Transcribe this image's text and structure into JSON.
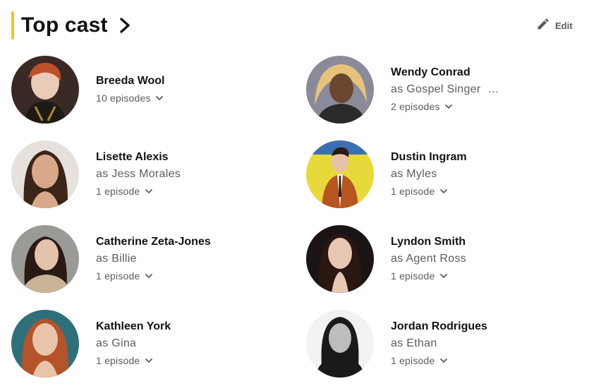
{
  "section": {
    "title": "Top cast",
    "edit_label": "Edit",
    "accent_color": "#f5c518"
  },
  "cast": [
    {
      "name": "Breeda Wool",
      "character": "",
      "episodes": "10 episodes",
      "avatar_bg": "#3a2a26",
      "avatar_fg": "#c0502a"
    },
    {
      "name": "Wendy Conrad",
      "character": "as Gospel Singer",
      "character_overflow": "…",
      "episodes": "2 episodes",
      "avatar_bg": "#8a8a9a",
      "avatar_fg": "#e6c27a"
    },
    {
      "name": "Lisette Alexis",
      "character": "as Jess Morales",
      "episodes": "1 episode",
      "avatar_bg": "#e6e1dc",
      "avatar_fg": "#3b2418"
    },
    {
      "name": "Dustin Ingram",
      "character": "as Myles",
      "episodes": "1 episode",
      "avatar_bg": "#e8d93a",
      "avatar_fg": "#b8541d"
    },
    {
      "name": "Catherine Zeta-Jones",
      "character": "as Billie",
      "episodes": "1 episode",
      "avatar_bg": "#9a9a96",
      "avatar_fg": "#2a1a14"
    },
    {
      "name": "Lyndon Smith",
      "character": "as Agent Ross",
      "episodes": "1 episode",
      "avatar_bg": "#1c1414",
      "avatar_fg": "#2a1712"
    },
    {
      "name": "Kathleen York",
      "character": "as Gina",
      "episodes": "1 episode",
      "avatar_bg": "#2f6f7a",
      "avatar_fg": "#b5532a"
    },
    {
      "name": "Jordan Rodrigues",
      "character": "as Ethan",
      "episodes": "1 episode",
      "avatar_bg": "#f2f2f2",
      "avatar_fg": "#1a1a1a"
    }
  ]
}
